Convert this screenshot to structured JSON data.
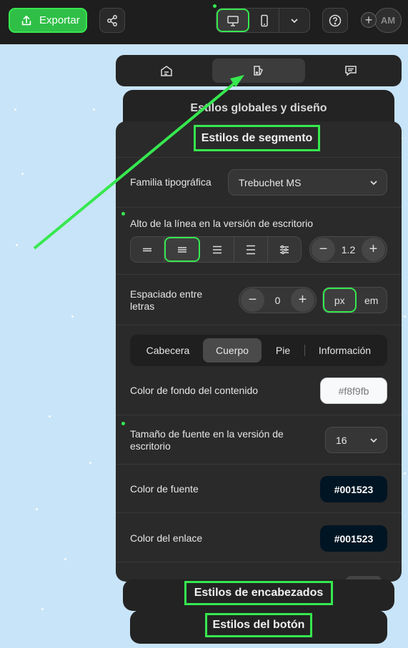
{
  "toolbar": {
    "export_label": "Exportar",
    "avatar_initials": "AM",
    "add_symbol": "+"
  },
  "tabs": [
    "content-blocks",
    "design-styles",
    "comments"
  ],
  "global_styles_title": "Estilos globales y diseño",
  "segment_styles": {
    "title": "Estilos de segmento",
    "font_family_label": "Familia tipográfica",
    "font_family_value": "Trebuchet MS",
    "line_height_label": "Alto de la línea en la versión de escritorio",
    "line_height_value": "1.2",
    "letter_spacing_label_1": "Espaciado entre",
    "letter_spacing_label_2": "letras",
    "letter_spacing_value": "0",
    "unit_px": "px",
    "unit_em": "em",
    "minus": "−",
    "plus": "+",
    "section_tabs": [
      "Cabecera",
      "Cuerpo",
      "Pie",
      "Información"
    ],
    "active_section_tab": "Cuerpo",
    "bg_color_label": "Color de fondo del contenido",
    "bg_color_value": "#f8f9fb",
    "font_size_label_1": "Tamaño de fuente en la versión de",
    "font_size_label_2": "escritorio",
    "font_size_value": "16",
    "font_color_label": "Color de fuente",
    "font_color_value": "#001523",
    "link_color_label": "Color del enlace",
    "link_color_value": "#001523"
  },
  "heading_styles_title": "Estilos de encabezados",
  "button_styles_title": "Estilos del botón",
  "colors": {
    "accent": "#36e84f",
    "export_bg": "#2fbf47",
    "panel_bg": "#2a2a2a",
    "dark_swatch": "#001523",
    "light_swatch": "#f8f9fb",
    "canvas_bg": "#c8e4f8"
  }
}
